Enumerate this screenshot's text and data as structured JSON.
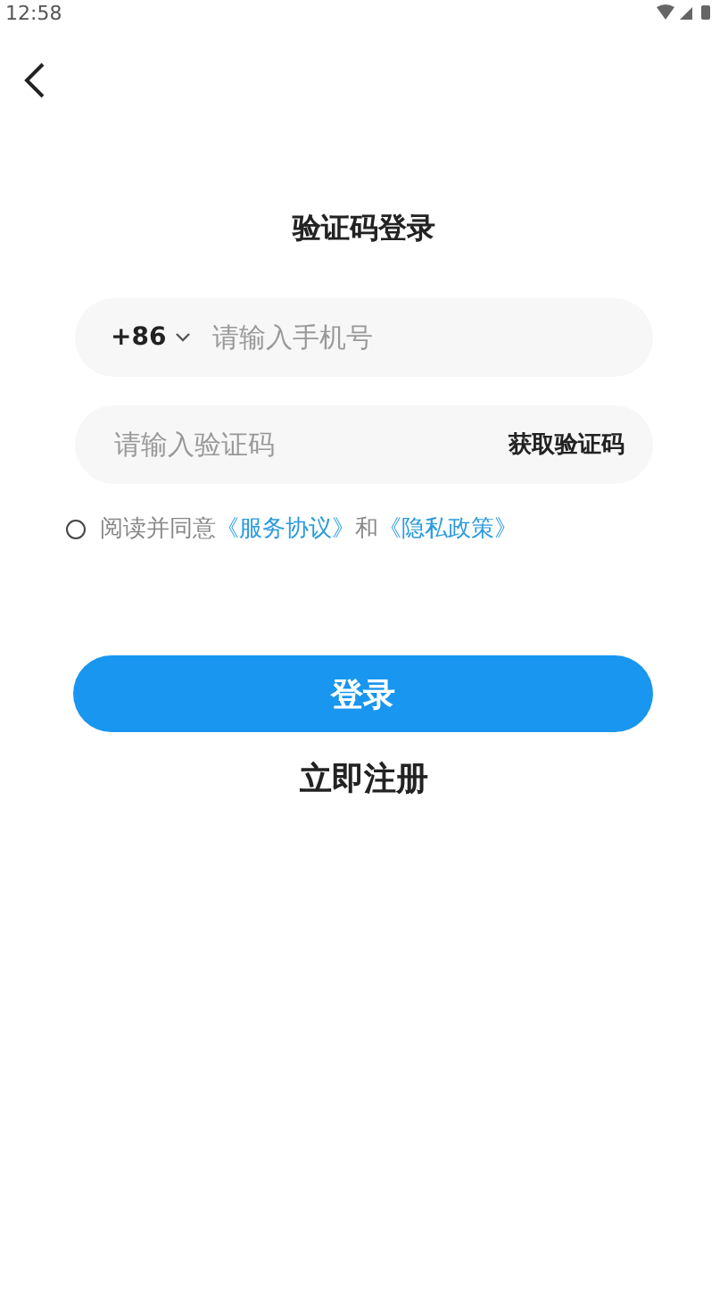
{
  "status_bar": {
    "time": "12:58"
  },
  "title": "验证码登录",
  "phone_field": {
    "country_code": "+86",
    "placeholder": "请输入手机号"
  },
  "code_field": {
    "placeholder": "请输入验证码",
    "action": "获取验证码"
  },
  "agreement": {
    "checked": false,
    "prefix": "阅读并同意",
    "terms_link": "《服务协议》",
    "conjunction": "和",
    "privacy_link": "《隐私政策》"
  },
  "login_button": "登录",
  "register_link": "立即注册"
}
